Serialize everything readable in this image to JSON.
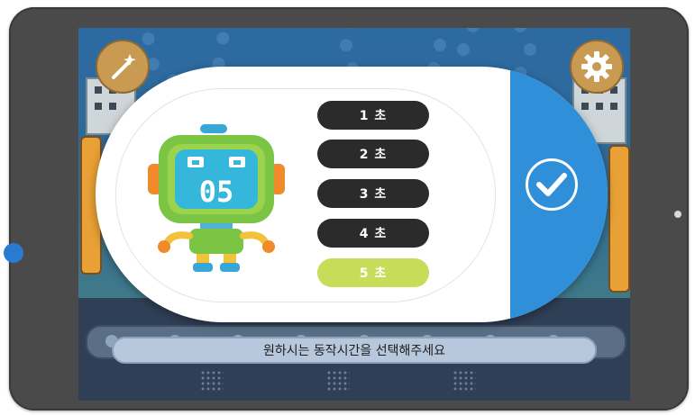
{
  "dialog": {
    "robot_display": "05",
    "options": [
      {
        "label": "1 초",
        "selected": false
      },
      {
        "label": "2 초",
        "selected": false
      },
      {
        "label": "3 초",
        "selected": false
      },
      {
        "label": "4 초",
        "selected": false
      },
      {
        "label": "5 초",
        "selected": true
      }
    ],
    "confirm_icon": "checkmark-icon"
  },
  "toolbar": {
    "left_icon": "magic-wand-icon",
    "right_icon": "gear-icon"
  },
  "instruction": "원하시는 동작시간을 선택해주세요",
  "colors": {
    "accent_blue": "#2f8fd8",
    "selected_option": "#c7dd5a",
    "option_dark": "#2b2b2b",
    "tablet_frame": "#4a4a4a"
  }
}
